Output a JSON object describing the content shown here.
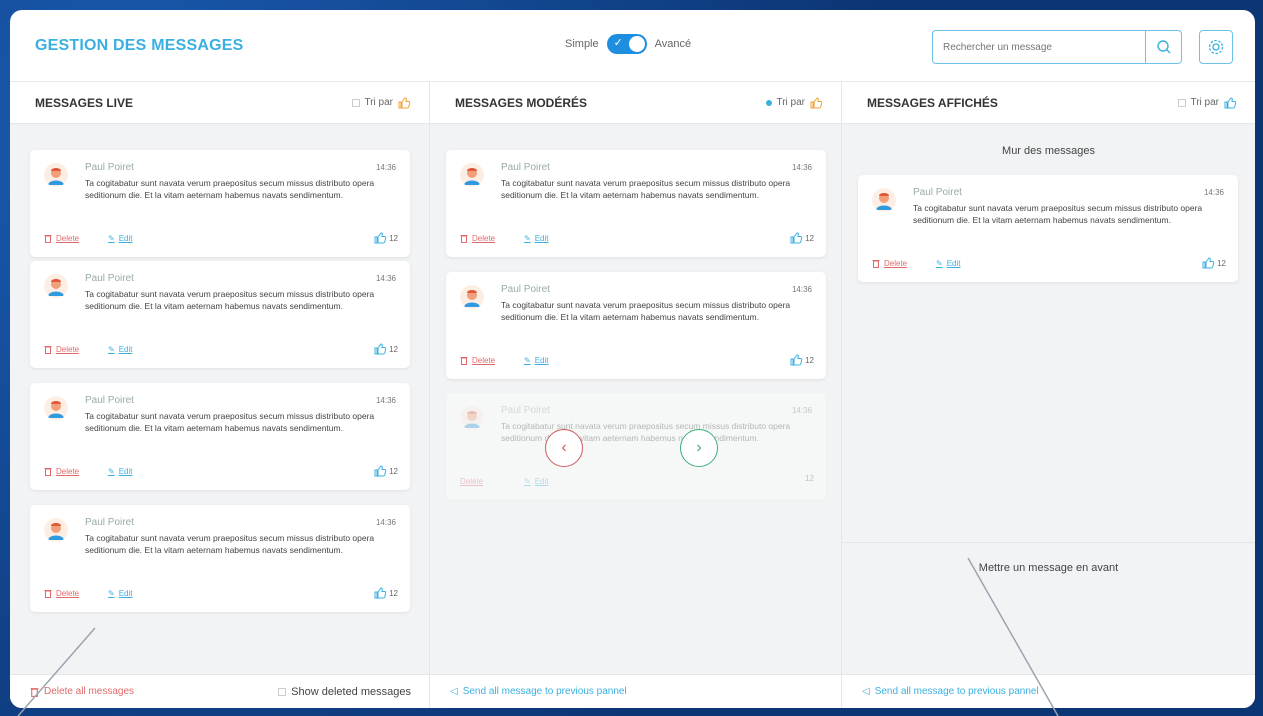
{
  "header": {
    "title": "GESTION DES MESSAGES",
    "mode_simple": "Simple",
    "mode_advanced": "Avancé",
    "search_placeholder": "Rechercher un message"
  },
  "columns": [
    {
      "title": "MESSAGES LIVE",
      "sort_label": "Tri par"
    },
    {
      "title": "MESSAGES MODÉRÉS",
      "sort_label": "Tri par"
    },
    {
      "title": "MESSAGES AFFICHÉS",
      "sort_label": "Tri par"
    }
  ],
  "message": {
    "author": "Paul Poiret",
    "time": "14:36",
    "text": "Ta cogitabatur sunt navata verum praepositus secum missus distributo opera seditionum die. Et la vitam aeternam habemus navats sendimentum.",
    "delete_label": "Delete",
    "edit_label": "Edit",
    "likes": "12"
  },
  "live_footer": {
    "delete_all": "Delete all messages",
    "show_deleted": "Show deleted messages"
  },
  "moderated_footer": {
    "send_previous": "Send all message to previous pannel"
  },
  "displayed": {
    "wall_label": "Mur des messages",
    "feature_label": "Mettre un message en avant",
    "send_previous": "Send all message to previous pannel"
  },
  "colors": {
    "accent": "#3bb0e0",
    "toggle": "#1d8ee0",
    "danger": "#e06a6a",
    "success": "#3cb07a"
  }
}
